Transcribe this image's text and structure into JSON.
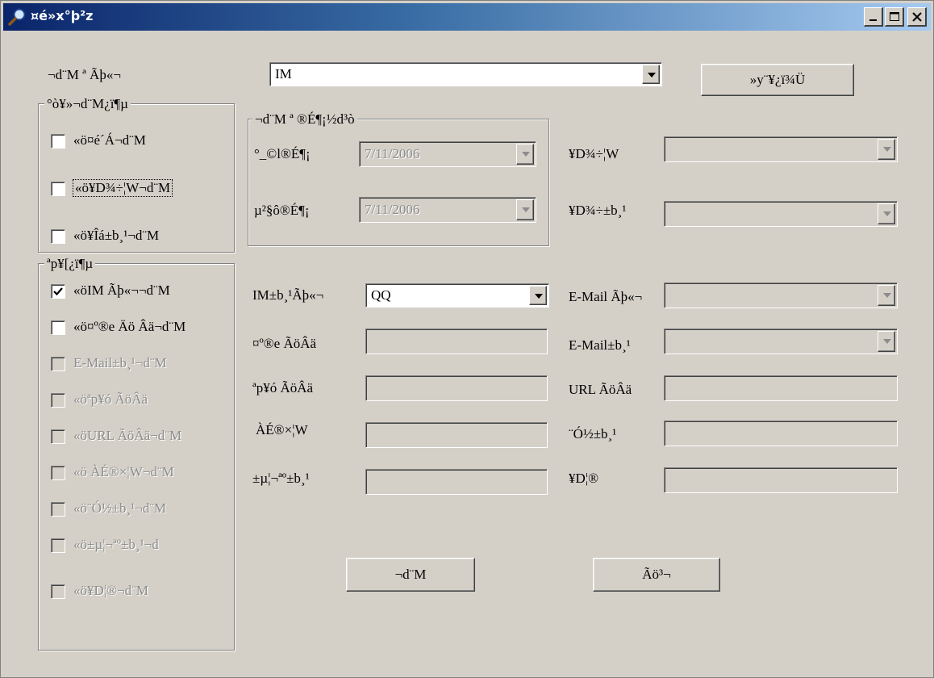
{
  "window": {
    "title": "¤é»x°þ²z",
    "icon": "magnifier-icon"
  },
  "top": {
    "account_type_label": "¬d¨M ª Ãþ«¬",
    "account_type_value": "IM",
    "search_button": "»y¨¥¿ï¾Ü"
  },
  "group1": {
    "title": "°ò¥»¬d¨M¿ï¶µ",
    "items": [
      {
        "label": "«ö¤é´Á¬d¨M",
        "checked": false,
        "enabled": true
      },
      {
        "label": "«ö¥D¾÷¦W¬d¨M",
        "checked": false,
        "enabled": true
      },
      {
        "label": "«ö¥Îá±b¸¹¬d¨M",
        "checked": false,
        "enabled": true
      }
    ]
  },
  "group2": {
    "title": "ªp¥[¿ï¶µ",
    "items": [
      {
        "label": "«öIM Ãþ«¬¬d¨M",
        "checked": true,
        "enabled": true
      },
      {
        "label": "«ö¤º®e Äö Âä¬d¨M",
        "checked": false,
        "enabled": true
      },
      {
        "label": "E-Mail±b¸¹¬d¨M",
        "checked": false,
        "enabled": false
      },
      {
        "label": "«öªp¥ó ÃöÂä",
        "checked": false,
        "enabled": false
      },
      {
        "label": "«öURL ÃöÂä¬d¨M",
        "checked": false,
        "enabled": false
      },
      {
        "label": "«ö ÀÉ®×¦W¬d¨M",
        "checked": false,
        "enabled": false
      },
      {
        "label": "«ö¨Ó½±b¸¹¬d¨M",
        "checked": false,
        "enabled": false
      },
      {
        "label": "«ö±µ¦¬ªº±b¸¹¬d",
        "checked": false,
        "enabled": false
      },
      {
        "label": "«ö¥D¦®¬d¨M",
        "checked": false,
        "enabled": false
      }
    ]
  },
  "date_group": {
    "title": "¬d¨M ª ®É¶¡½d³ò",
    "start_label": "°_©l®É¶¡",
    "start_value": "7/11/2006",
    "end_label": "µ²§ô®É¶¡",
    "end_value": "7/11/2006"
  },
  "right_fields": {
    "host_label": "¥D¾÷¦W",
    "host_value": "",
    "host_account_label": "¥D¾÷±b¸¹",
    "host_account_value": ""
  },
  "form": {
    "im_account_type_label": "IM±b¸¹Ãþ«¬",
    "im_account_type_value": "QQ",
    "content_keyword_label": "¤º®e ÃöÂä",
    "content_keyword_value": "",
    "attach_keyword_label": "ªp¥ó ÃöÂä",
    "attach_keyword_value": "",
    "filename_label": "ÀÉ®×¦W",
    "filename_value": "",
    "receiver_account_label": "±µ¦¬ªº±b¸¹",
    "receiver_account_value": "",
    "email_type_label": "E-Mail Ãþ«¬",
    "email_type_value": "",
    "email_account_label": "E-Mail±b¸¹",
    "email_account_value": "",
    "url_keyword_label": "URL ÃöÂä",
    "url_keyword_value": "",
    "sender_account_label": "¨Ó½±b¸¹",
    "sender_account_value": "",
    "subject_label": "¥D¦®",
    "subject_value": ""
  },
  "buttons": {
    "query": "¬d¨M",
    "cancel": "Ãö³¬"
  }
}
